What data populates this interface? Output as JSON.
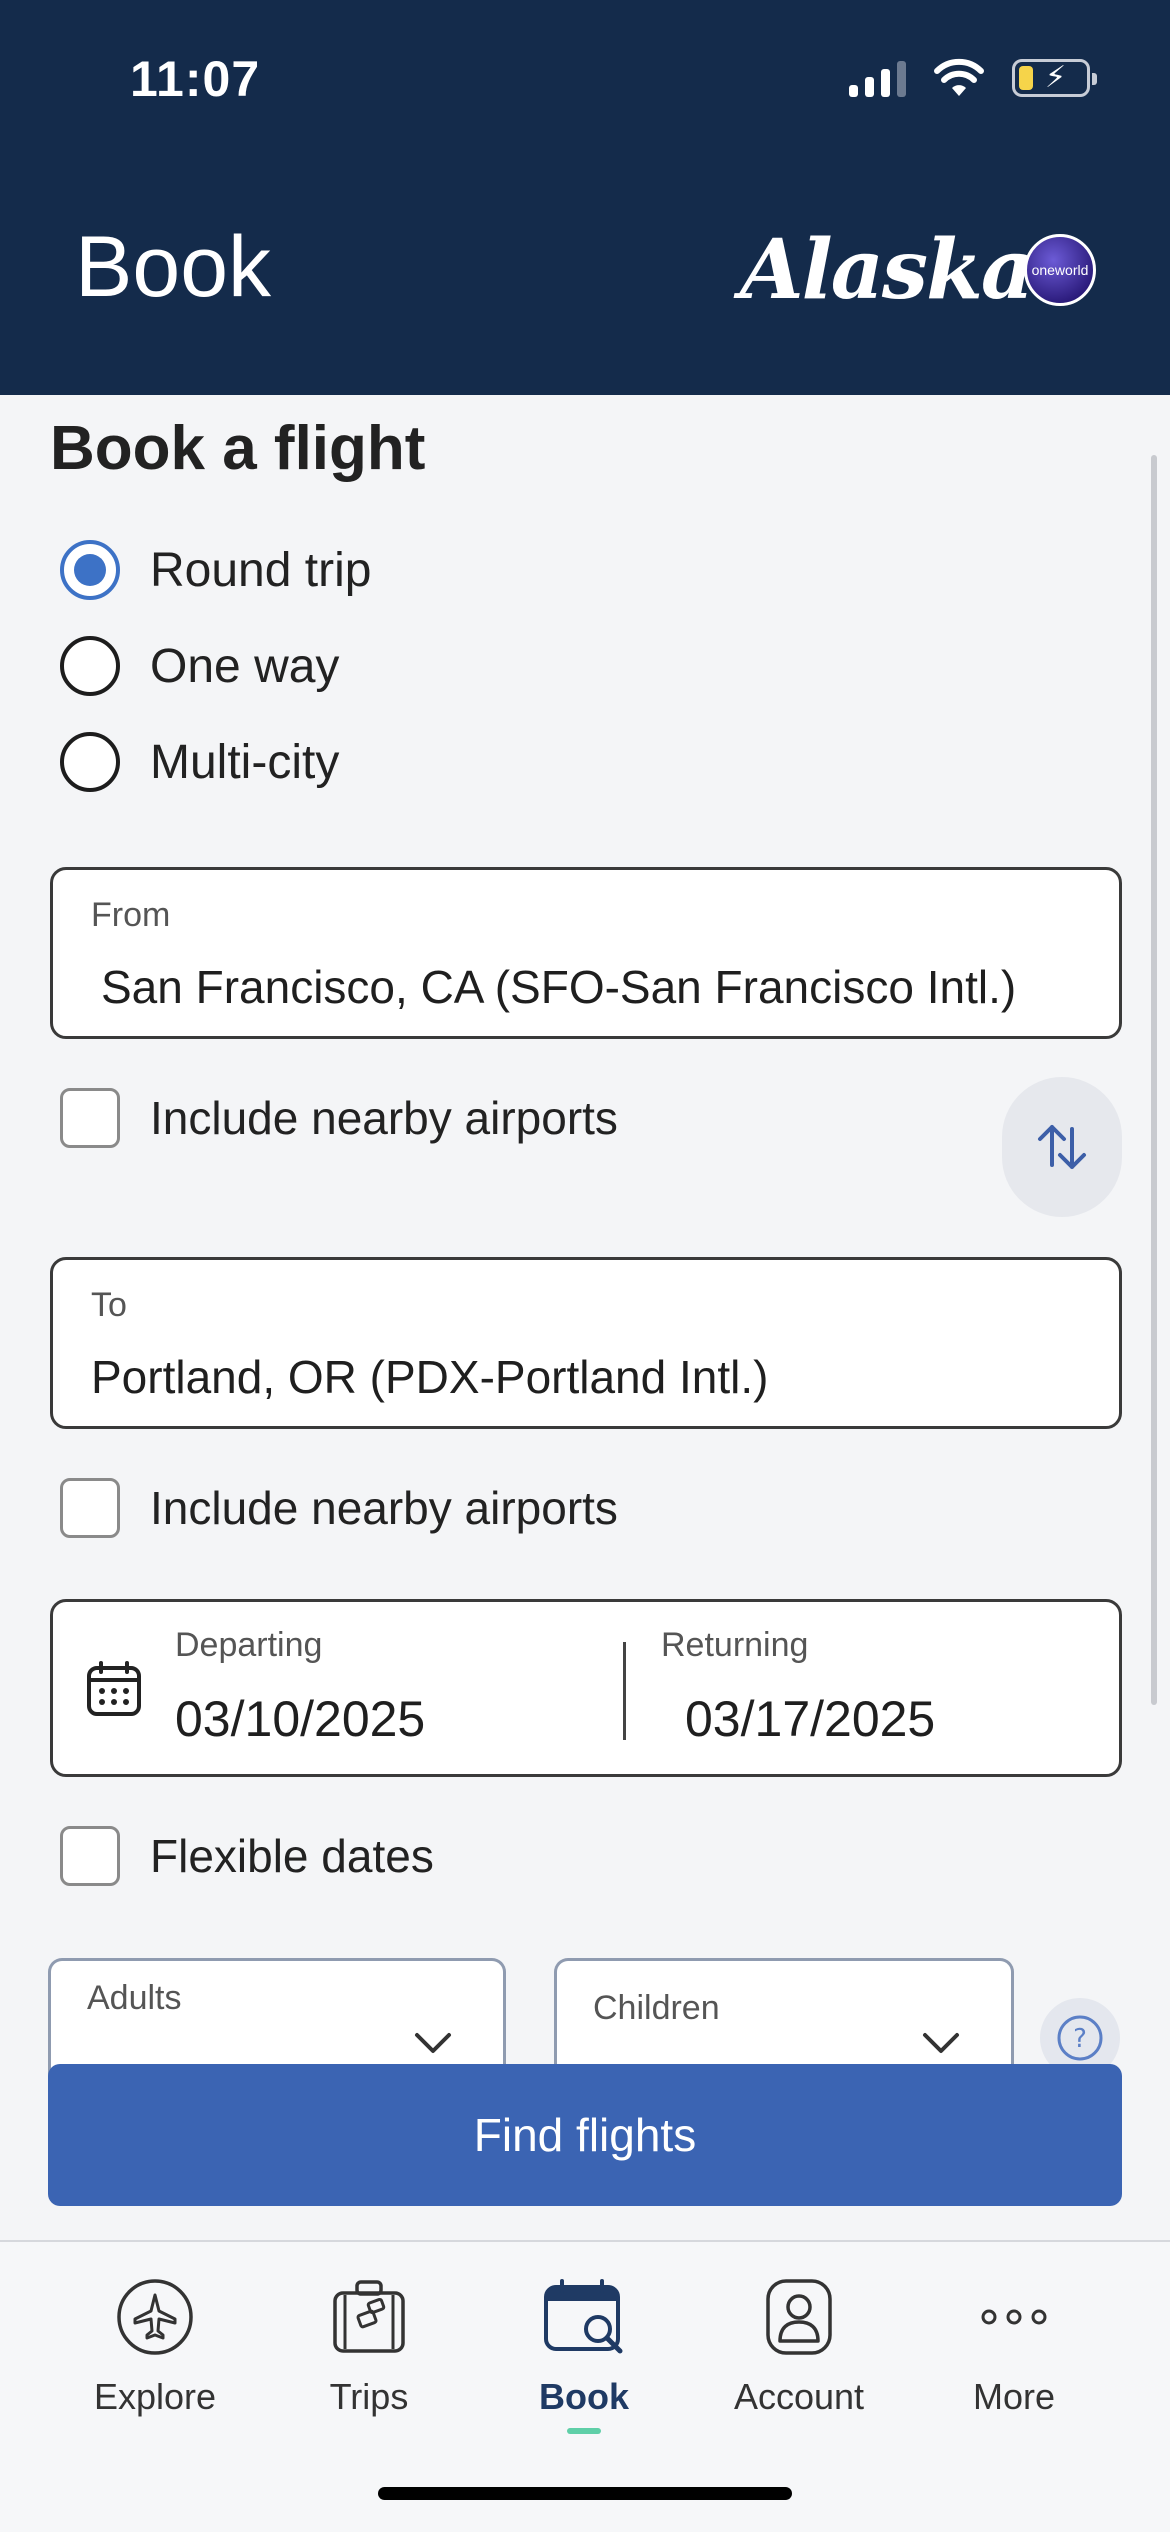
{
  "status_bar": {
    "time": "11:07"
  },
  "header": {
    "title": "Book",
    "brand": "Alaska",
    "alliance": "oneworld"
  },
  "form": {
    "title": "Book a flight",
    "trip_types": [
      {
        "label": "Round trip",
        "selected": true
      },
      {
        "label": "One way",
        "selected": false
      },
      {
        "label": "Multi-city",
        "selected": false
      }
    ],
    "from": {
      "label": "From",
      "value": "San Francisco, CA (SFO-San Francisco Intl.)"
    },
    "from_nearby": "Include nearby airports",
    "to": {
      "label": "To",
      "value": "Portland, OR (PDX-Portland Intl.)"
    },
    "to_nearby": "Include nearby airports",
    "departing": {
      "label": "Departing",
      "value": "03/10/2025"
    },
    "returning": {
      "label": "Returning",
      "value": "03/17/2025"
    },
    "flexible_dates": "Flexible dates",
    "adults": {
      "label": "Adults"
    },
    "children": {
      "label": "Children"
    },
    "submit": "Find flights"
  },
  "tabbar": {
    "tabs": [
      {
        "label": "Explore",
        "icon": "plane-icon"
      },
      {
        "label": "Trips",
        "icon": "suitcase-icon"
      },
      {
        "label": "Book",
        "icon": "calendar-search-icon",
        "active": true
      },
      {
        "label": "Account",
        "icon": "account-icon"
      },
      {
        "label": "More",
        "icon": "more-dots-icon"
      }
    ]
  },
  "colors": {
    "header_bg": "#142b4b",
    "accent": "#3d72c6",
    "button": "#3b64b3",
    "active_indicator": "#5fcfa8"
  }
}
